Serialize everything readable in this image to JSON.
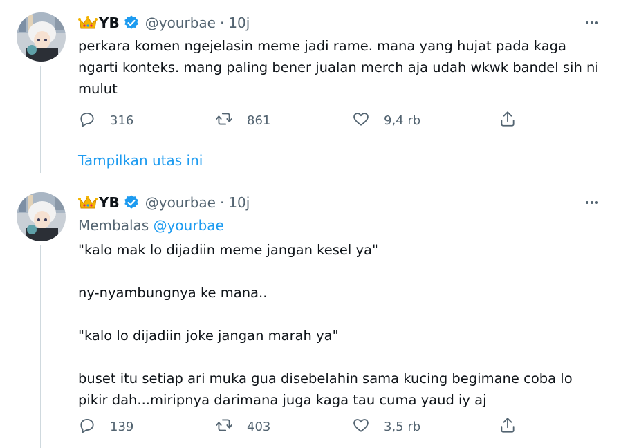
{
  "tweets": [
    {
      "display_name": "YB",
      "handle": "@yourbae",
      "dot": "·",
      "time": "10j",
      "reply_prefix": "",
      "reply_handle": "",
      "text": "perkara komen ngejelasin meme jadi rame. mana yang hujat pada kaga ngarti konteks. mang paling bener jualan merch aja udah wkwk bandel sih ni mulut",
      "replies": "316",
      "retweets": "861",
      "likes": "9,4 rb"
    },
    {
      "display_name": "YB",
      "handle": "@yourbae",
      "dot": "·",
      "time": "10j",
      "reply_prefix": "Membalas",
      "reply_handle": "@yourbae",
      "text": "\"kalo mak lo dijadiin meme jangan kesel ya\"\n\nny-nyambungnya ke mana..\n\n\"kalo lo dijadiin joke jangan marah ya\"\n\nbuset itu setiap ari muka gua disebelahin sama kucing begimane coba lo pikir dah...miripnya darimana juga kaga tau cuma yaud iy aj",
      "replies": "139",
      "retweets": "403",
      "likes": "3,5 rb"
    }
  ],
  "show_thread": "Tampilkan utas ini",
  "colors": {
    "accent": "#1d9bf0",
    "secondary_text": "#536471",
    "line": "#cfd9de"
  },
  "icons": [
    "crown-emoji-icon",
    "verified-badge-icon",
    "more-options-icon",
    "reply-icon",
    "retweet-icon",
    "like-icon",
    "share-icon"
  ]
}
